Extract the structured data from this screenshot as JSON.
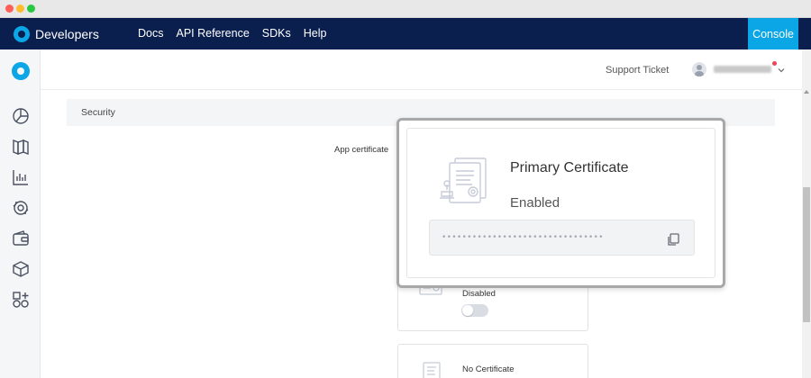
{
  "topnav": {
    "brand": "Developers",
    "links": [
      "Docs",
      "API Reference",
      "SDKs",
      "Help"
    ],
    "console_label": "Console",
    "brand_color": "#0b1f4f",
    "accent_color": "#0aa6e6"
  },
  "rail": {
    "icons": [
      "logo-icon",
      "dashboard-pie-icon",
      "projects-book-icon",
      "usage-chart-icon",
      "support-icon",
      "billing-wallet-icon",
      "extensions-cube-icon",
      "marketplace-grid-icon"
    ]
  },
  "header": {
    "support_label": "Support Ticket",
    "username_redacted": true
  },
  "security": {
    "section_title": "Security",
    "field_label": "App certificate",
    "primary": {
      "title": "Primary Certificate",
      "status": "Enabled",
      "masked_value": "••••••••••••••••••••••••••••••••"
    },
    "secondary": {
      "status": "Disabled",
      "toggle_on": false
    },
    "tertiary": {
      "status": "No Certificate"
    }
  }
}
